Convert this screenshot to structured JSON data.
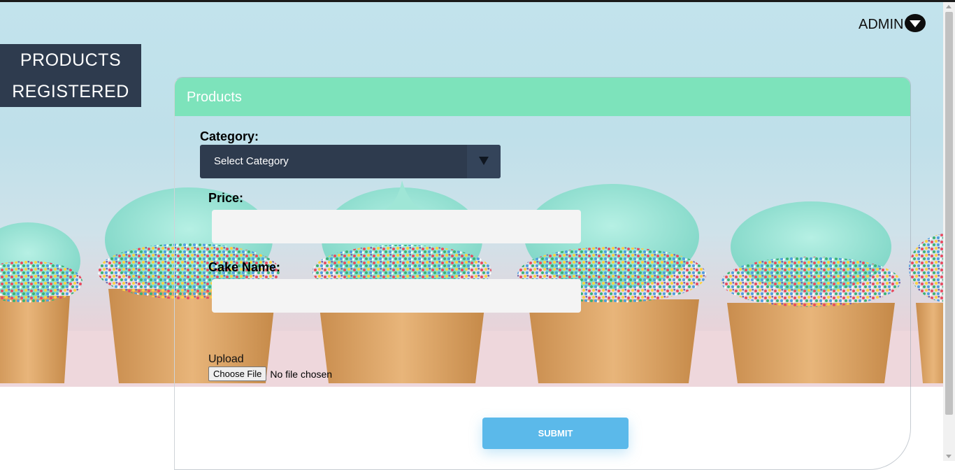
{
  "nav": {
    "side_menu_line1": "PRODUCTS",
    "side_menu_line2": "REGISTERED",
    "admin_label": "ADMIN",
    "admin_icon": "chevron-down-icon"
  },
  "card": {
    "title": "Products",
    "header_color": "#7de3bb"
  },
  "form": {
    "category_label": "Category:",
    "category_value": "Select Category",
    "price_label": "Price:",
    "price_value": "",
    "cake_name_label": "Cake Name:",
    "cake_name_value": "",
    "upload_label": "Upload",
    "file_button_label": "Choose File",
    "file_status": "No file chosen",
    "submit_label": "SUBMIT"
  },
  "colors": {
    "menu_bg": "#2e3b4e",
    "submit_bg": "#5bb9ea"
  }
}
